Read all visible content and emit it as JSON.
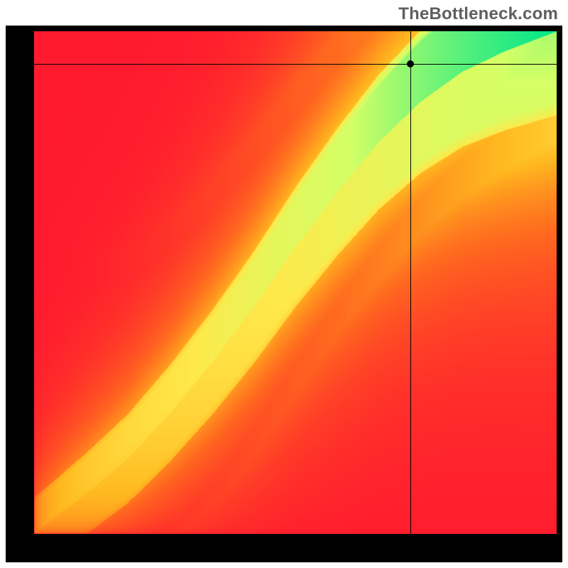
{
  "attribution": "TheBottleneck.com",
  "chart_data": {
    "type": "heatmap",
    "title": "",
    "xlabel": "",
    "ylabel": "",
    "xlim": [
      0,
      100
    ],
    "ylim": [
      0,
      100
    ],
    "color_stops": [
      {
        "t": 0.0,
        "color": "#ff1a2e"
      },
      {
        "t": 0.3,
        "color": "#ff6a1f"
      },
      {
        "t": 0.55,
        "color": "#ffb81f"
      },
      {
        "t": 0.78,
        "color": "#ffe84a"
      },
      {
        "t": 0.9,
        "color": "#d4ff66"
      },
      {
        "t": 1.0,
        "color": "#00e68a"
      }
    ],
    "optimal_ridge": [
      {
        "x": 0,
        "y": 0
      },
      {
        "x": 5,
        "y": 4
      },
      {
        "x": 10,
        "y": 8
      },
      {
        "x": 18,
        "y": 15
      },
      {
        "x": 26,
        "y": 24
      },
      {
        "x": 34,
        "y": 34
      },
      {
        "x": 42,
        "y": 45
      },
      {
        "x": 50,
        "y": 57
      },
      {
        "x": 58,
        "y": 68
      },
      {
        "x": 66,
        "y": 78
      },
      {
        "x": 74,
        "y": 86
      },
      {
        "x": 82,
        "y": 92
      },
      {
        "x": 90,
        "y": 96
      },
      {
        "x": 100,
        "y": 100
      }
    ],
    "ridge_width_base": 6,
    "ridge_width_tip": 14,
    "marker": {
      "x": 72,
      "y": 93.5
    },
    "crosshair": {
      "x": 72,
      "y": 93.5
    }
  }
}
